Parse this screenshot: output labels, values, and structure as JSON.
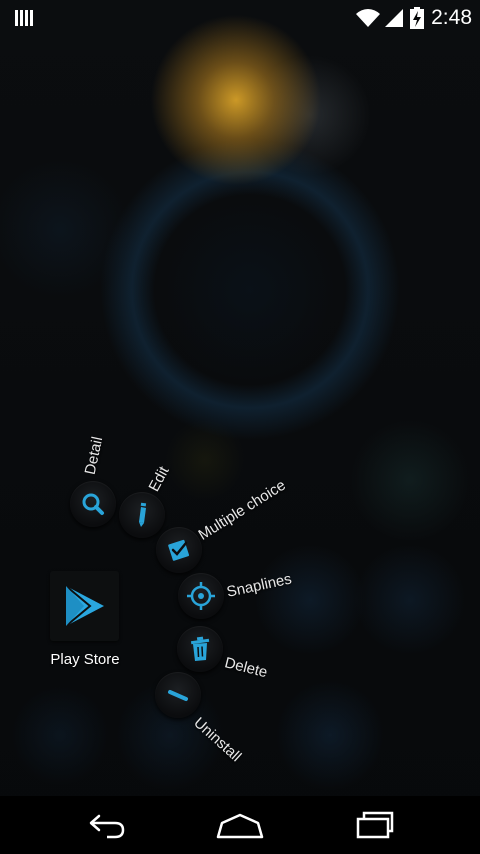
{
  "status_bar": {
    "time": "2:48",
    "icons": [
      "notification-bars-icon",
      "wifi-icon",
      "signal-icon",
      "battery-charging-icon"
    ]
  },
  "app": {
    "label": "Play Store",
    "icon": "play-store-icon"
  },
  "radial_menu": {
    "items": [
      {
        "label": "Detail",
        "icon": "magnifier-icon"
      },
      {
        "label": "Edit",
        "icon": "pencil-icon"
      },
      {
        "label": "Multiple choice",
        "icon": "checkbox-icon"
      },
      {
        "label": "Snaplines",
        "icon": "crosshair-icon"
      },
      {
        "label": "Delete",
        "icon": "trash-icon"
      },
      {
        "label": "Uninstall",
        "icon": "minus-icon"
      }
    ],
    "accent_color": "#29a4d9"
  },
  "nav_bar": {
    "buttons": [
      "back-icon",
      "home-icon",
      "recent-apps-icon"
    ]
  }
}
